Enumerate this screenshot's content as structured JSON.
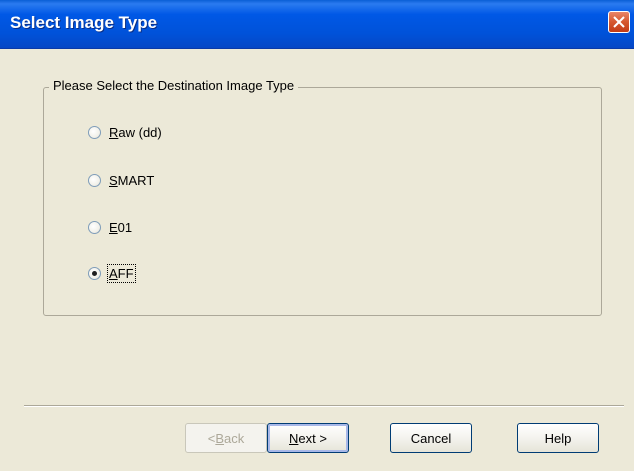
{
  "window": {
    "title": "Select Image Type"
  },
  "group": {
    "legend": "Please Select the Destination Image Type",
    "options": [
      {
        "pre": "",
        "mnemonic": "R",
        "post": "aw (dd)",
        "checked": false
      },
      {
        "pre": "",
        "mnemonic": "S",
        "post": "MART",
        "checked": false
      },
      {
        "pre": "",
        "mnemonic": "E",
        "post": "01",
        "checked": false
      },
      {
        "pre": "",
        "mnemonic": "A",
        "post": "FF",
        "checked": true
      }
    ]
  },
  "buttons": {
    "back": {
      "pre": "< ",
      "mnemonic": "B",
      "post": "ack",
      "disabled": true
    },
    "next": {
      "pre": "",
      "mnemonic": "N",
      "post": "ext >"
    },
    "cancel": "Cancel",
    "help": "Help"
  }
}
